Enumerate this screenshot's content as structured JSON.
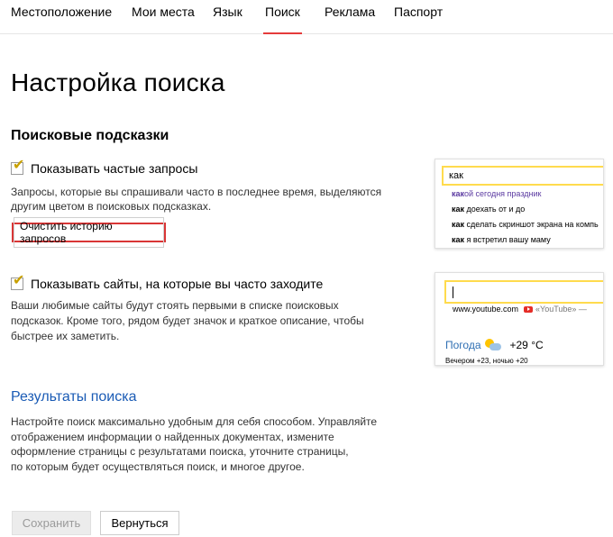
{
  "nav": {
    "items": [
      {
        "label": "Местоположение",
        "active": false
      },
      {
        "label": "Мои места",
        "active": false
      },
      {
        "label": "Язык",
        "active": false
      },
      {
        "label": "Поиск",
        "active": true
      },
      {
        "label": "Реклама",
        "active": false
      },
      {
        "label": "Паспорт",
        "active": false
      }
    ],
    "active_underline_color": "#e53b3b"
  },
  "page": {
    "title": "Настройка поиска"
  },
  "suggestions_section": {
    "title": "Поисковые подсказки",
    "frequent_queries": {
      "checked": true,
      "label": "Показывать частые запросы",
      "desc_line1": "Запросы, которые вы спрашивали часто в последнее время, выделяются",
      "desc_line2": "другим цветом в поисковых подсказках.",
      "clear_button_label": "Очистить историю запросов"
    },
    "frequent_sites": {
      "checked": true,
      "label": "Показывать сайты, на которые вы часто заходите",
      "desc_line1": "Ваши любимые сайты будут стоять первыми в списке поисковых",
      "desc_line2": "подсказок. Кроме того, рядом будет значок и краткое описание, чтобы",
      "desc_line3": "быстрее их заметить."
    }
  },
  "preview_queries": {
    "input_value": "как",
    "suggestions": [
      {
        "bold": "как",
        "rest": "ой сегодня праздник",
        "highlighted": true
      },
      {
        "bold": "как",
        "rest": " доехать от и до",
        "highlighted": false
      },
      {
        "bold": "как",
        "rest": " сделать скриншот экрана на компь",
        "highlighted": false
      },
      {
        "bold": "как",
        "rest": " я встретил вашу маму",
        "highlighted": false
      }
    ]
  },
  "preview_sites": {
    "site": "www.youtube.com",
    "site_icon": "youtube-icon",
    "site_desc": "«YouTube» —",
    "weather_city": "Погода",
    "weather_icon": "sun-cloud-icon",
    "weather_temp": "+29 °C",
    "forecast": "Вечером +23,   ночью +20"
  },
  "results_section": {
    "title": "Результаты поиска",
    "desc_line1": "Настройте поиск максимально удобным для себя способом. Управляйте",
    "desc_line2": "отображением информации о найденных документах, измените",
    "desc_line3": "оформление страницы с результатами поиска, уточните страницы,",
    "desc_line4": "по которым будет осуществляться поиск, и многое другое."
  },
  "actions": {
    "save_label": "Сохранить",
    "save_disabled": true,
    "back_label": "Вернуться"
  }
}
